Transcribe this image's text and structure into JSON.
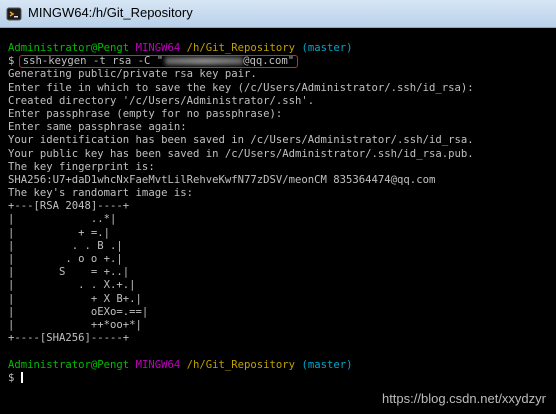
{
  "window": {
    "title": "MINGW64:/h/Git_Repository",
    "icon": "git-bash-icon"
  },
  "prompt": {
    "user": "Administrator@Pengt",
    "system": "MINGW64",
    "path": "/h/Git_Repository",
    "branch": "(master)",
    "symbol": "$"
  },
  "command": {
    "prefix": "ssh-keygen -t rsa -C \"",
    "email_suffix": "@qq.com\""
  },
  "output": [
    "Generating public/private rsa key pair.",
    "Enter file in which to save the key (/c/Users/Administrator/.ssh/id_rsa):",
    "Created directory '/c/Users/Administrator/.ssh'.",
    "Enter passphrase (empty for no passphrase):",
    "Enter same passphrase again:",
    "Your identification has been saved in /c/Users/Administrator/.ssh/id_rsa.",
    "Your public key has been saved in /c/Users/Administrator/.ssh/id_rsa.pub.",
    "The key fingerprint is:",
    "SHA256:U7+daD1whcNxFaeMvtLilRehveKwfN77zDSV/meonCM 835364474@qq.com",
    "The key's randomart image is:",
    "+---[RSA 2048]----+",
    "|            ..*|",
    "|          + =.|",
    "|         . . B .|",
    "|        . o o +.|",
    "|       S    = +..|",
    "|          . . X.+.|",
    "|            + X B+.|",
    "|            oEXo=.==|",
    "|            ++*oo+*|",
    "+----[SHA256]-----+"
  ],
  "watermark": "https://blog.csdn.net/xxydzyr"
}
